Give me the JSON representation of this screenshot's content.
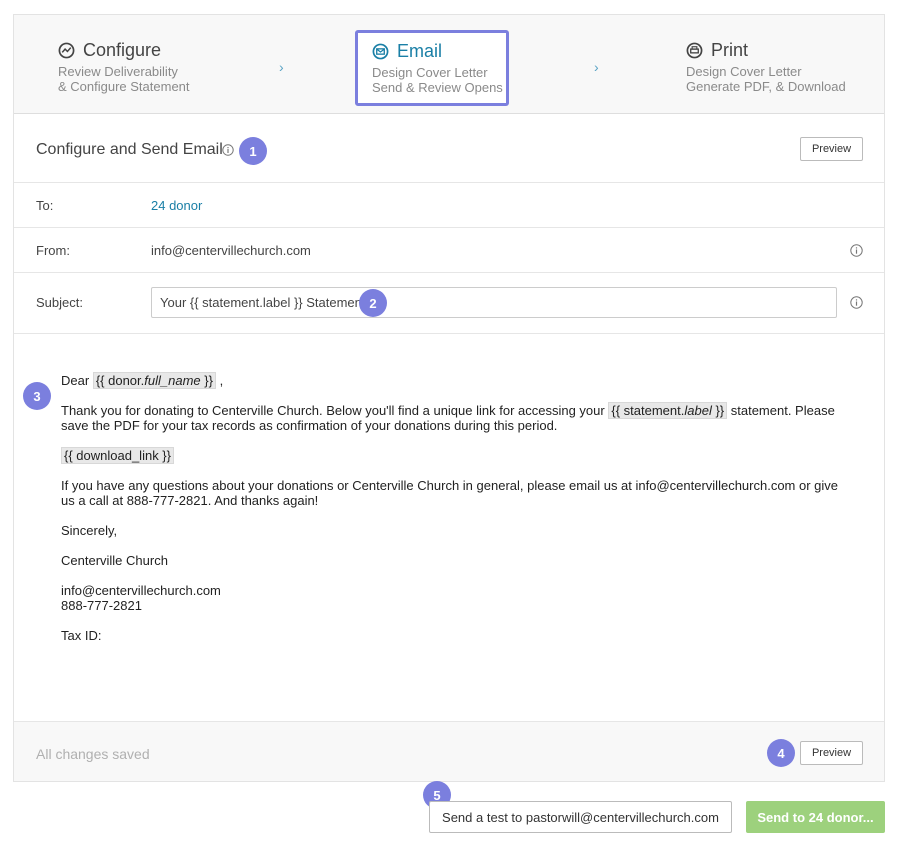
{
  "steps": [
    {
      "title": "Configure",
      "line1": "Review Deliverability",
      "line2": "& Configure Statement",
      "icon": "chart-circle-icon"
    },
    {
      "title": "Email",
      "line1": "Design Cover Letter",
      "line2": "Send & Review Opens",
      "icon": "envelope-circle-icon"
    },
    {
      "title": "Print",
      "line1": "Design Cover Letter",
      "line2": "Generate PDF, & Download",
      "icon": "printer-circle-icon"
    }
  ],
  "step_separator": "›",
  "header": {
    "title": "Configure and Send Email",
    "preview_label": "Preview"
  },
  "fields": {
    "to_label": "To:",
    "to_value": "24 donor",
    "from_label": "From:",
    "from_value": "info@centervillechurch.com",
    "subject_label": "Subject:",
    "subject_value": "Your {{ statement.label }} Statement"
  },
  "body": {
    "greeting_prefix": "Dear",
    "greeting_tag_open": "{{ donor.",
    "greeting_tag_var": "full_name",
    "greeting_tag_close": " }}",
    "greeting_suffix": ",",
    "p1_a": "Thank you for donating to Centerville Church. Below you'll find a unique link for accessing your",
    "p1_tag_open": "{{ statement.",
    "p1_tag_var": "label",
    "p1_tag_close": " }}",
    "p1_b": "statement. Please save the PDF for your tax records as confirmation of your donations during this period.",
    "download_tag": "{{ download_link }}",
    "p2": "If you have any questions about your donations or Centerville Church in general, please email us at info@centervillechurch.com or give us a call at 888-777-2821. And thanks again!",
    "sign_off": "Sincerely,",
    "org_name": "Centerville Church",
    "contact_email": "info@centervillechurch.com",
    "contact_phone": "888-777-2821",
    "tax_id": "Tax ID:"
  },
  "footer": {
    "saved_status": "All changes saved",
    "preview_label": "Preview"
  },
  "actions": {
    "test_label": "Send a test to pastorwill@centervillechurch.com",
    "send_label": "Send to 24 donor..."
  },
  "badges": [
    "1",
    "2",
    "3",
    "4",
    "5"
  ],
  "colors": {
    "accent": "#7b7fde",
    "link": "#1a7fa6",
    "send_button": "#9dd17d"
  }
}
